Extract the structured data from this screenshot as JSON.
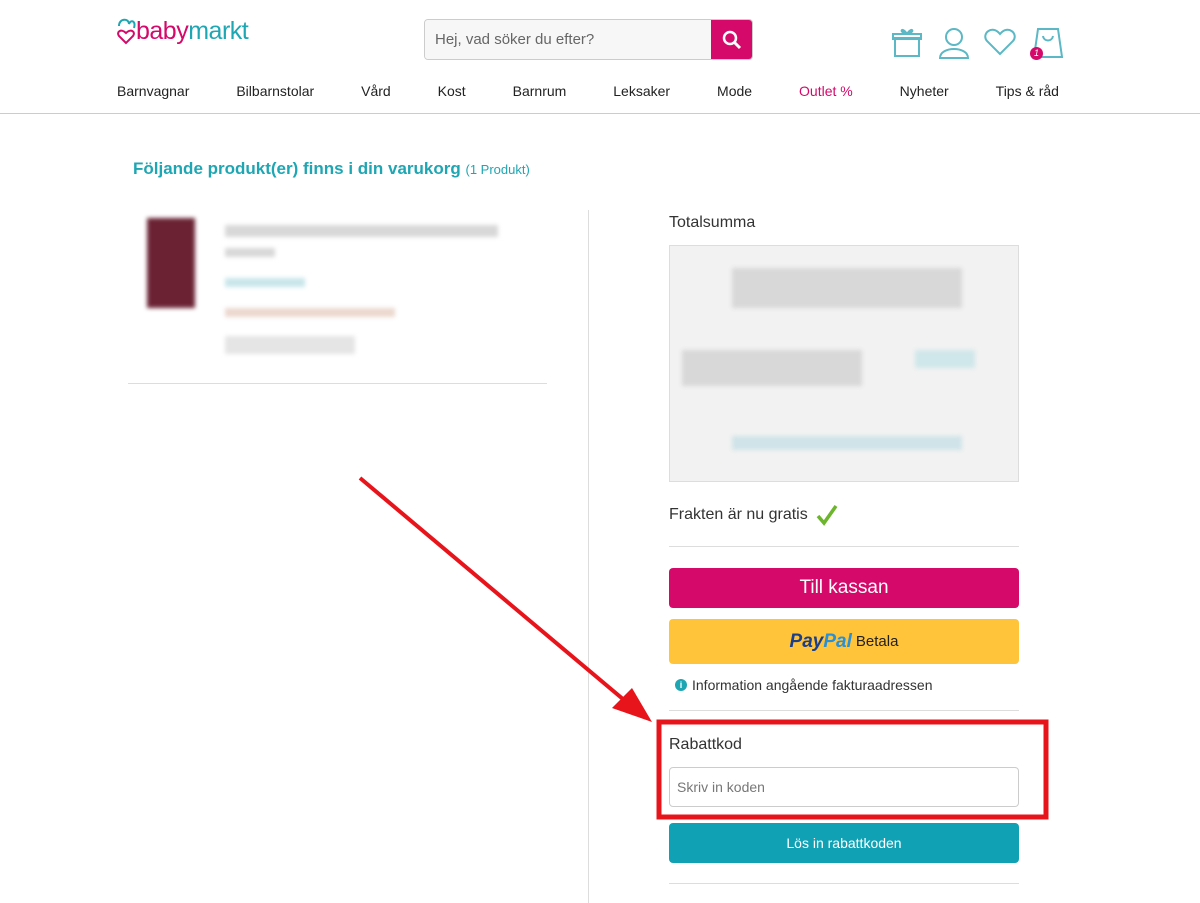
{
  "header": {
    "logo": {
      "part1": "baby",
      "part2": "markt"
    },
    "search_placeholder": "Hej, vad söker du efter?",
    "cart_count": "1"
  },
  "nav": [
    "Barnvagnar",
    "Bilbarnstolar",
    "Vård",
    "Kost",
    "Barnrum",
    "Leksaker",
    "Mode",
    "Outlet %",
    "Nyheter",
    "Tips & råd"
  ],
  "cart": {
    "title": "Följande produkt(er) finns i din varukorg",
    "count": "(1 Produkt)"
  },
  "summary": {
    "heading": "Totalsumma",
    "shipping": "Frakten är nu gratis",
    "checkout": "Till kassan",
    "paypal_brand1": "Pay",
    "paypal_brand2": "Pal",
    "paypal_label": "Betala",
    "info": "Information angående fakturaadressen",
    "coupon_heading": "Rabattkod",
    "coupon_placeholder": "Skriv in koden",
    "coupon_value": "",
    "redeem": "Lös in rabattkoden"
  },
  "colors": {
    "brand_pink": "#d4096a",
    "brand_teal": "#1fa6b3",
    "annotation": "#e8141b"
  }
}
